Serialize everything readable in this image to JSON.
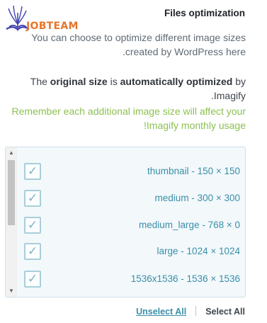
{
  "logo": {
    "text": "JOBTEAM"
  },
  "section": {
    "title": "Files optimization"
  },
  "intro": "You can choose to optimize different image sizes created by WordPress here.",
  "original": {
    "prefix": "The ",
    "bold1": "original size",
    "middle": " is ",
    "bold2": "automatically optimized",
    "suffix": " by Imagify."
  },
  "warning": "Remember each additional image size will affect your Imagify monthly usage!",
  "sizes": [
    {
      "label": "thumbnail - 150 × 150",
      "checked": true
    },
    {
      "label": "medium - 300 × 300",
      "checked": true
    },
    {
      "label": "medium_large - 768 × 0",
      "checked": true
    },
    {
      "label": "large - 1024 × 1024",
      "checked": true
    },
    {
      "label": "1536x1536 - 1536 × 1536",
      "checked": true
    }
  ],
  "actions": {
    "unselect_all": "Unselect All",
    "select_all": "Select All"
  },
  "colors": {
    "accent": "#3a8fa8",
    "warning": "#8cc152",
    "logo": "#e7752a",
    "logo_icon": "#3f3fb0"
  }
}
